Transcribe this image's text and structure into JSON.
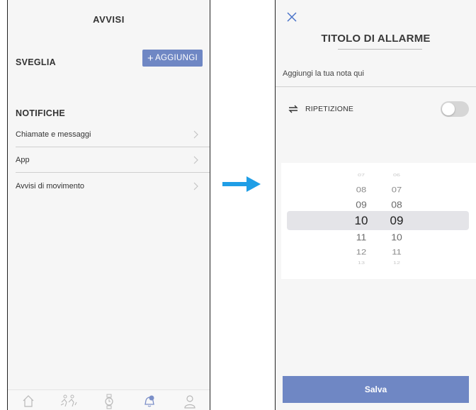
{
  "left": {
    "title": "AVVISI",
    "alarm_section": "SVEGLIA",
    "add_button": {
      "icon": "+",
      "label": "AGGIUNGI"
    },
    "notifications_section": "NOTIFICHE",
    "rows": [
      {
        "label": "Chiamate e messaggi"
      },
      {
        "label": "App"
      },
      {
        "label": "Avvisi di movimento"
      }
    ],
    "tabbar": [
      {
        "icon": "home-icon",
        "active": false
      },
      {
        "icon": "activity-icon",
        "active": false
      },
      {
        "icon": "watch-icon",
        "active": false
      },
      {
        "icon": "alarm-bell-icon",
        "active": true
      },
      {
        "icon": "profile-icon",
        "active": false
      }
    ]
  },
  "right": {
    "title": "TITOLO DI ALLARME",
    "note_placeholder": "Aggiungi la tua nota qui",
    "repeat_label": "RIPETIZIONE",
    "repeat_on": false,
    "picker": {
      "hours": [
        "07",
        "08",
        "09",
        "10",
        "11",
        "12",
        "13"
      ],
      "minutes": [
        "06",
        "07",
        "08",
        "09",
        "10",
        "11",
        "12"
      ],
      "selected_hour": "10",
      "selected_minute": "09"
    },
    "save_label": "Salva"
  },
  "colors": {
    "accent": "#6f87c4",
    "arrow": "#1f9ee6"
  }
}
